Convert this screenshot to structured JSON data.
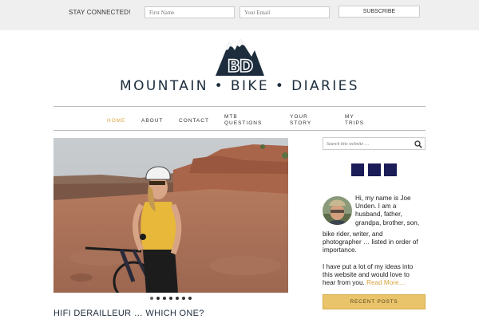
{
  "topbar": {
    "label": "STAY CONNECTED!",
    "first_name_placeholder": "First Name",
    "email_placeholder": "Your Email",
    "subscribe_label": "SUBSCRIBE"
  },
  "logo": {
    "text": "MOUNTAIN • BIKE • DIARIES",
    "mark_letters": "BD"
  },
  "nav": {
    "items": [
      {
        "line1": "HOME",
        "line2": ""
      },
      {
        "line1": "ABOUT",
        "line2": ""
      },
      {
        "line1": "CONTACT",
        "line2": ""
      },
      {
        "line1": "MTB",
        "line2": "QUESTIONS"
      },
      {
        "line1": "YOUR",
        "line2": "STORY"
      },
      {
        "line1": "MY",
        "line2": "TRIPS"
      }
    ],
    "active_index": 0
  },
  "slider": {
    "slide_count": 7,
    "active_index": 0
  },
  "post": {
    "title": "HIFI DERAILLEUR … WHICH ONE?"
  },
  "sidebar": {
    "search_placeholder": "Search this website …",
    "social_count": 3,
    "bio_lines": [
      "Hi, my name is Joe",
      "Unden. I am a",
      "husband, father,",
      "grandpa, brother, son,"
    ],
    "bio_lines_full": [
      "bike rider, writer, and",
      "photographer … listed in order of",
      "importance."
    ],
    "bio2_lines": [
      "I have put a lot of my ideas into",
      "this website and would love to"
    ],
    "bio2_last": "hear from you. ",
    "read_more": "Read More…",
    "recent_posts_label": "RECENT POSTS"
  },
  "colors": {
    "accent": "#d9a441",
    "brand": "#1d2d3d",
    "social": "#1a1d57",
    "recent_bg": "#e9c46a"
  }
}
